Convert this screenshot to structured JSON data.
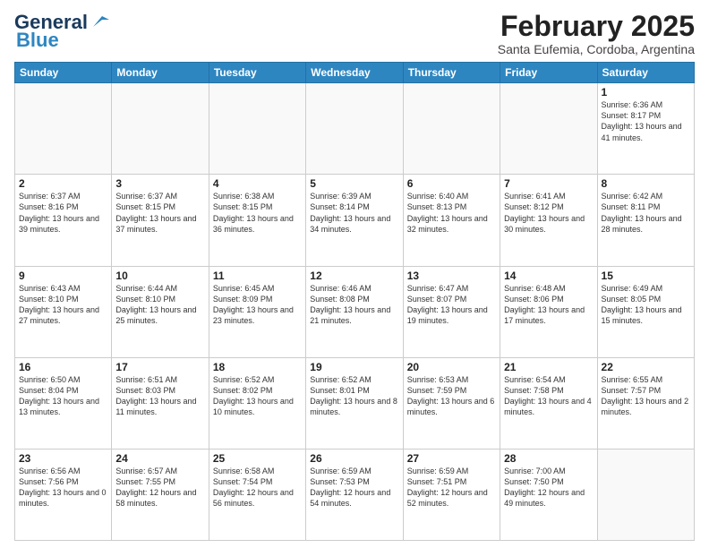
{
  "header": {
    "logo_line1": "General",
    "logo_line2": "Blue",
    "title": "February 2025",
    "subtitle": "Santa Eufemia, Cordoba, Argentina"
  },
  "days_of_week": [
    "Sunday",
    "Monday",
    "Tuesday",
    "Wednesday",
    "Thursday",
    "Friday",
    "Saturday"
  ],
  "weeks": [
    [
      {
        "day": "",
        "info": ""
      },
      {
        "day": "",
        "info": ""
      },
      {
        "day": "",
        "info": ""
      },
      {
        "day": "",
        "info": ""
      },
      {
        "day": "",
        "info": ""
      },
      {
        "day": "",
        "info": ""
      },
      {
        "day": "1",
        "info": "Sunrise: 6:36 AM\nSunset: 8:17 PM\nDaylight: 13 hours\nand 41 minutes."
      }
    ],
    [
      {
        "day": "2",
        "info": "Sunrise: 6:37 AM\nSunset: 8:16 PM\nDaylight: 13 hours\nand 39 minutes."
      },
      {
        "day": "3",
        "info": "Sunrise: 6:37 AM\nSunset: 8:15 PM\nDaylight: 13 hours\nand 37 minutes."
      },
      {
        "day": "4",
        "info": "Sunrise: 6:38 AM\nSunset: 8:15 PM\nDaylight: 13 hours\nand 36 minutes."
      },
      {
        "day": "5",
        "info": "Sunrise: 6:39 AM\nSunset: 8:14 PM\nDaylight: 13 hours\nand 34 minutes."
      },
      {
        "day": "6",
        "info": "Sunrise: 6:40 AM\nSunset: 8:13 PM\nDaylight: 13 hours\nand 32 minutes."
      },
      {
        "day": "7",
        "info": "Sunrise: 6:41 AM\nSunset: 8:12 PM\nDaylight: 13 hours\nand 30 minutes."
      },
      {
        "day": "8",
        "info": "Sunrise: 6:42 AM\nSunset: 8:11 PM\nDaylight: 13 hours\nand 28 minutes."
      }
    ],
    [
      {
        "day": "9",
        "info": "Sunrise: 6:43 AM\nSunset: 8:10 PM\nDaylight: 13 hours\nand 27 minutes."
      },
      {
        "day": "10",
        "info": "Sunrise: 6:44 AM\nSunset: 8:10 PM\nDaylight: 13 hours\nand 25 minutes."
      },
      {
        "day": "11",
        "info": "Sunrise: 6:45 AM\nSunset: 8:09 PM\nDaylight: 13 hours\nand 23 minutes."
      },
      {
        "day": "12",
        "info": "Sunrise: 6:46 AM\nSunset: 8:08 PM\nDaylight: 13 hours\nand 21 minutes."
      },
      {
        "day": "13",
        "info": "Sunrise: 6:47 AM\nSunset: 8:07 PM\nDaylight: 13 hours\nand 19 minutes."
      },
      {
        "day": "14",
        "info": "Sunrise: 6:48 AM\nSunset: 8:06 PM\nDaylight: 13 hours\nand 17 minutes."
      },
      {
        "day": "15",
        "info": "Sunrise: 6:49 AM\nSunset: 8:05 PM\nDaylight: 13 hours\nand 15 minutes."
      }
    ],
    [
      {
        "day": "16",
        "info": "Sunrise: 6:50 AM\nSunset: 8:04 PM\nDaylight: 13 hours\nand 13 minutes."
      },
      {
        "day": "17",
        "info": "Sunrise: 6:51 AM\nSunset: 8:03 PM\nDaylight: 13 hours\nand 11 minutes."
      },
      {
        "day": "18",
        "info": "Sunrise: 6:52 AM\nSunset: 8:02 PM\nDaylight: 13 hours\nand 10 minutes."
      },
      {
        "day": "19",
        "info": "Sunrise: 6:52 AM\nSunset: 8:01 PM\nDaylight: 13 hours\nand 8 minutes."
      },
      {
        "day": "20",
        "info": "Sunrise: 6:53 AM\nSunset: 7:59 PM\nDaylight: 13 hours\nand 6 minutes."
      },
      {
        "day": "21",
        "info": "Sunrise: 6:54 AM\nSunset: 7:58 PM\nDaylight: 13 hours\nand 4 minutes."
      },
      {
        "day": "22",
        "info": "Sunrise: 6:55 AM\nSunset: 7:57 PM\nDaylight: 13 hours\nand 2 minutes."
      }
    ],
    [
      {
        "day": "23",
        "info": "Sunrise: 6:56 AM\nSunset: 7:56 PM\nDaylight: 13 hours\nand 0 minutes."
      },
      {
        "day": "24",
        "info": "Sunrise: 6:57 AM\nSunset: 7:55 PM\nDaylight: 12 hours\nand 58 minutes."
      },
      {
        "day": "25",
        "info": "Sunrise: 6:58 AM\nSunset: 7:54 PM\nDaylight: 12 hours\nand 56 minutes."
      },
      {
        "day": "26",
        "info": "Sunrise: 6:59 AM\nSunset: 7:53 PM\nDaylight: 12 hours\nand 54 minutes."
      },
      {
        "day": "27",
        "info": "Sunrise: 6:59 AM\nSunset: 7:51 PM\nDaylight: 12 hours\nand 52 minutes."
      },
      {
        "day": "28",
        "info": "Sunrise: 7:00 AM\nSunset: 7:50 PM\nDaylight: 12 hours\nand 49 minutes."
      },
      {
        "day": "",
        "info": ""
      }
    ]
  ]
}
